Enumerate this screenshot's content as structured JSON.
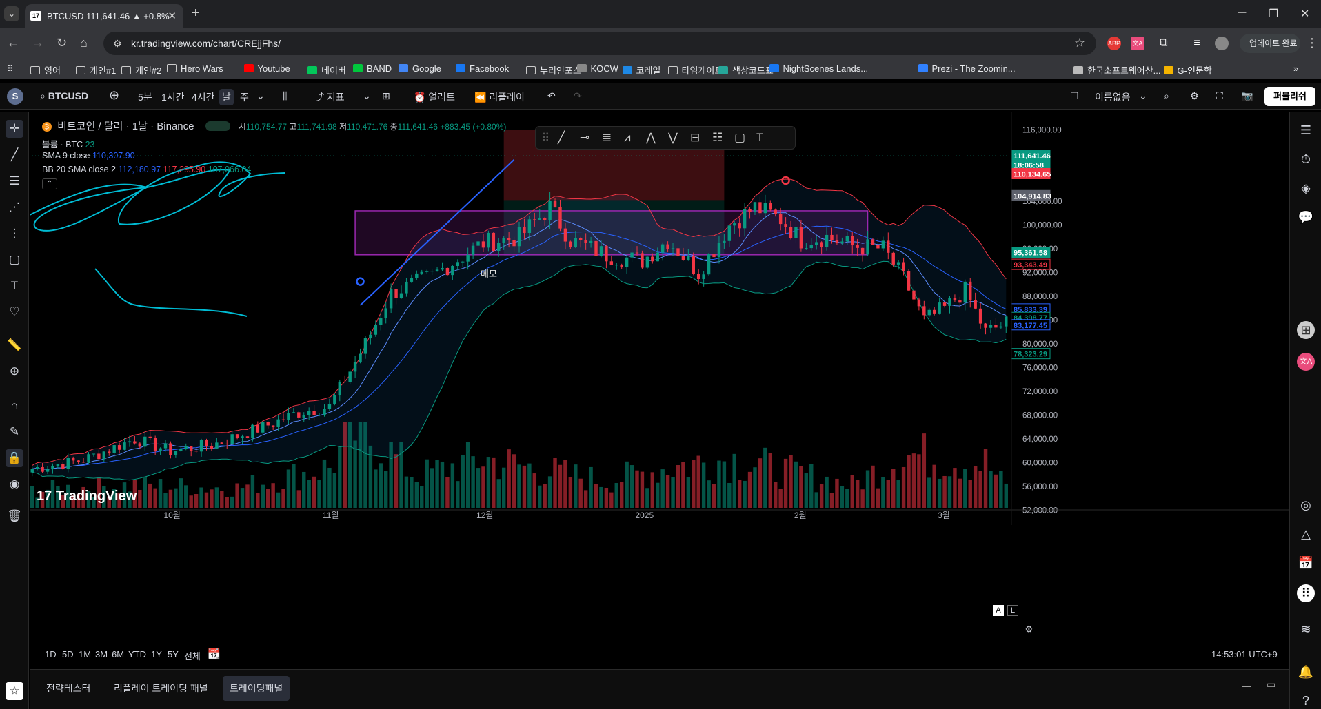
{
  "browser": {
    "tab_title": "BTCUSD 111,641.46 ▲ +0.8%",
    "url": "kr.tradingview.com/chart/CREjjFhs/",
    "update_label": "업데이트 완료",
    "bookmarks": [
      {
        "label": "영어",
        "icon": "folder-icon"
      },
      {
        "label": "개인#1",
        "icon": "folder-icon"
      },
      {
        "label": "개인#2",
        "icon": "folder-icon"
      },
      {
        "label": "Hero Wars",
        "icon": "folder-icon"
      },
      {
        "label": "Youtube",
        "icon": "youtube-icon"
      },
      {
        "label": "네이버",
        "icon": "naver-icon"
      },
      {
        "label": "BAND",
        "icon": "band-icon"
      },
      {
        "label": "Google",
        "icon": "google-icon"
      },
      {
        "label": "Facebook",
        "icon": "facebook-icon"
      },
      {
        "label": "누리인포스",
        "icon": "folder-icon"
      },
      {
        "label": "KOCW",
        "icon": "kocw-icon"
      },
      {
        "label": "코레일",
        "icon": "korail-icon"
      },
      {
        "label": "타임게이트",
        "icon": "folder-icon"
      },
      {
        "label": "색상코드표",
        "icon": "color-icon"
      },
      {
        "label": "NightScenes Lands...",
        "icon": "facebook-icon"
      },
      {
        "label": "Prezi - The Zoomin...",
        "icon": "prezi-icon"
      },
      {
        "label": "한국소프트웨어산...",
        "icon": "globe-icon"
      },
      {
        "label": "G-인문학",
        "icon": "g-icon"
      }
    ]
  },
  "toolbar": {
    "avatar_letter": "S",
    "symbol": "BTCUSD",
    "timeframes": [
      "5분",
      "1시간",
      "4시간",
      "날",
      "주"
    ],
    "active_timeframe": "날",
    "indicators_label": "지표",
    "alerts_label": "얼러트",
    "replay_label": "리플레이",
    "layout_name": "이름없음",
    "publish_label": "퍼블리쉬"
  },
  "legend": {
    "coin_letter": "₿",
    "title": "비트코인 / 달러 · 1날 · Binance",
    "ohlc_o_label": "시",
    "ohlc_o": "110,754.77",
    "ohlc_h_label": "고",
    "ohlc_h": "111,741.98",
    "ohlc_l_label": "저",
    "ohlc_l": "110,471.76",
    "ohlc_c_label": "종",
    "ohlc_c": "111,641.46",
    "change": "+883.45 (+0.80%)",
    "volume_label": "볼륨 · BTC",
    "volume_value": "23",
    "sma_label": "SMA 9 close",
    "sma_value": "110,307.90",
    "bb_label": "BB 20 SMA close 2",
    "bb_basis": "112,180.97",
    "bb_upper": "117,295.90",
    "bb_lower": "107,066.04"
  },
  "memo_text": "메모",
  "watermark": "TradingView",
  "price_axis": {
    "ticks": [
      "116,000.00",
      "104,000.00",
      "100,000.00",
      "96,000.00",
      "92,000.00",
      "88,000.00",
      "84,000.00",
      "80,000.00",
      "76,000.00",
      "72,000.00",
      "68,000.00",
      "64,000.00",
      "60,000.00",
      "56,000.00",
      "52,000.00"
    ],
    "tick_values": [
      116000,
      104000,
      100000,
      96000,
      92000,
      88000,
      84000,
      80000,
      76000,
      72000,
      68000,
      64000,
      60000,
      56000,
      52000
    ],
    "labels": [
      {
        "text": "111,641.46",
        "value": 111641.46,
        "bg": "#089981"
      },
      {
        "text": "18:06:58",
        "value": 110100,
        "bg": "#089981"
      },
      {
        "text": "110,134.65",
        "value": 108600,
        "bg": "#f23645"
      },
      {
        "text": "104,914.83",
        "value": 104914.83,
        "bg": "#5d606b"
      },
      {
        "text": "95,361.58",
        "value": 95361.58,
        "bg": "#089981"
      },
      {
        "text": "93,343.49",
        "value": 93343.49,
        "bg": "#f23645",
        "outline": true
      },
      {
        "text": "85,833.39",
        "value": 85833.39,
        "bg": "#2962ff",
        "outline": true
      },
      {
        "text": "84,398.77",
        "value": 84398.77,
        "bg": "#089981",
        "outline": true
      },
      {
        "text": "83,177.45",
        "value": 83177.45,
        "bg": "#2962ff",
        "outline": true
      },
      {
        "text": "78,323.29",
        "value": 78323.29,
        "bg": "#089981",
        "outline": true
      }
    ]
  },
  "time_axis": {
    "labels": [
      {
        "text": "10월",
        "index": 27
      },
      {
        "text": "11월",
        "index": 58
      },
      {
        "text": "12월",
        "index": 88
      },
      {
        "text": "2025",
        "index": 119
      },
      {
        "text": "2월",
        "index": 150
      },
      {
        "text": "3월",
        "index": 178
      }
    ]
  },
  "ranges": [
    "1D",
    "5D",
    "1M",
    "3M",
    "6M",
    "YTD",
    "1Y",
    "5Y",
    "전체"
  ],
  "clock": "14:53:01 UTC+9",
  "bottom_tabs": [
    "전략테스터",
    "리플레이 트레이딩 패널",
    "트레이딩패널"
  ],
  "active_bottom_tab": "트레이딩패널",
  "colors": {
    "up": "#089981",
    "down": "#f23645",
    "sma": "#2962ff",
    "bb_upper": "#f23645",
    "bb_lower": "#089981",
    "bb_basis": "#2962ff",
    "drawing": "#00bcd4",
    "rectangle": "#9c27b0"
  },
  "chart_data": {
    "type": "candlestick",
    "symbol": "BTCUSD",
    "interval": "1D",
    "y_axis_range": [
      50000,
      117000
    ],
    "ohlc_control_points": [
      [
        0,
        59000
      ],
      [
        10,
        60500
      ],
      [
        20,
        64000
      ],
      [
        27,
        62000
      ],
      [
        35,
        63000
      ],
      [
        45,
        66000
      ],
      [
        52,
        68500
      ],
      [
        58,
        69500
      ],
      [
        62,
        75500
      ],
      [
        65,
        80000
      ],
      [
        70,
        88500
      ],
      [
        78,
        91500
      ],
      [
        88,
        97000
      ],
      [
        95,
        98000
      ],
      [
        101,
        103000
      ],
      [
        105,
        97500
      ],
      [
        112,
        95000
      ],
      [
        119,
        94000
      ],
      [
        124,
        97500
      ],
      [
        130,
        92000
      ],
      [
        136,
        100000
      ],
      [
        141,
        103000
      ],
      [
        146,
        101000
      ],
      [
        150,
        97500
      ],
      [
        155,
        98000
      ],
      [
        160,
        96500
      ],
      [
        166,
        96000
      ],
      [
        170,
        91000
      ],
      [
        174,
        84000
      ],
      [
        178,
        86000
      ],
      [
        182,
        89000
      ],
      [
        186,
        82000
      ],
      [
        190,
        83500
      ]
    ],
    "volume_control_points": [
      [
        0,
        20
      ],
      [
        20,
        25
      ],
      [
        40,
        22
      ],
      [
        58,
        45
      ],
      [
        63,
        85
      ],
      [
        68,
        70
      ],
      [
        75,
        35
      ],
      [
        88,
        55
      ],
      [
        101,
        40
      ],
      [
        112,
        30
      ],
      [
        124,
        45
      ],
      [
        136,
        55
      ],
      [
        146,
        42
      ],
      [
        160,
        25
      ],
      [
        170,
        60
      ],
      [
        178,
        55
      ],
      [
        186,
        50
      ],
      [
        190,
        23
      ]
    ]
  }
}
